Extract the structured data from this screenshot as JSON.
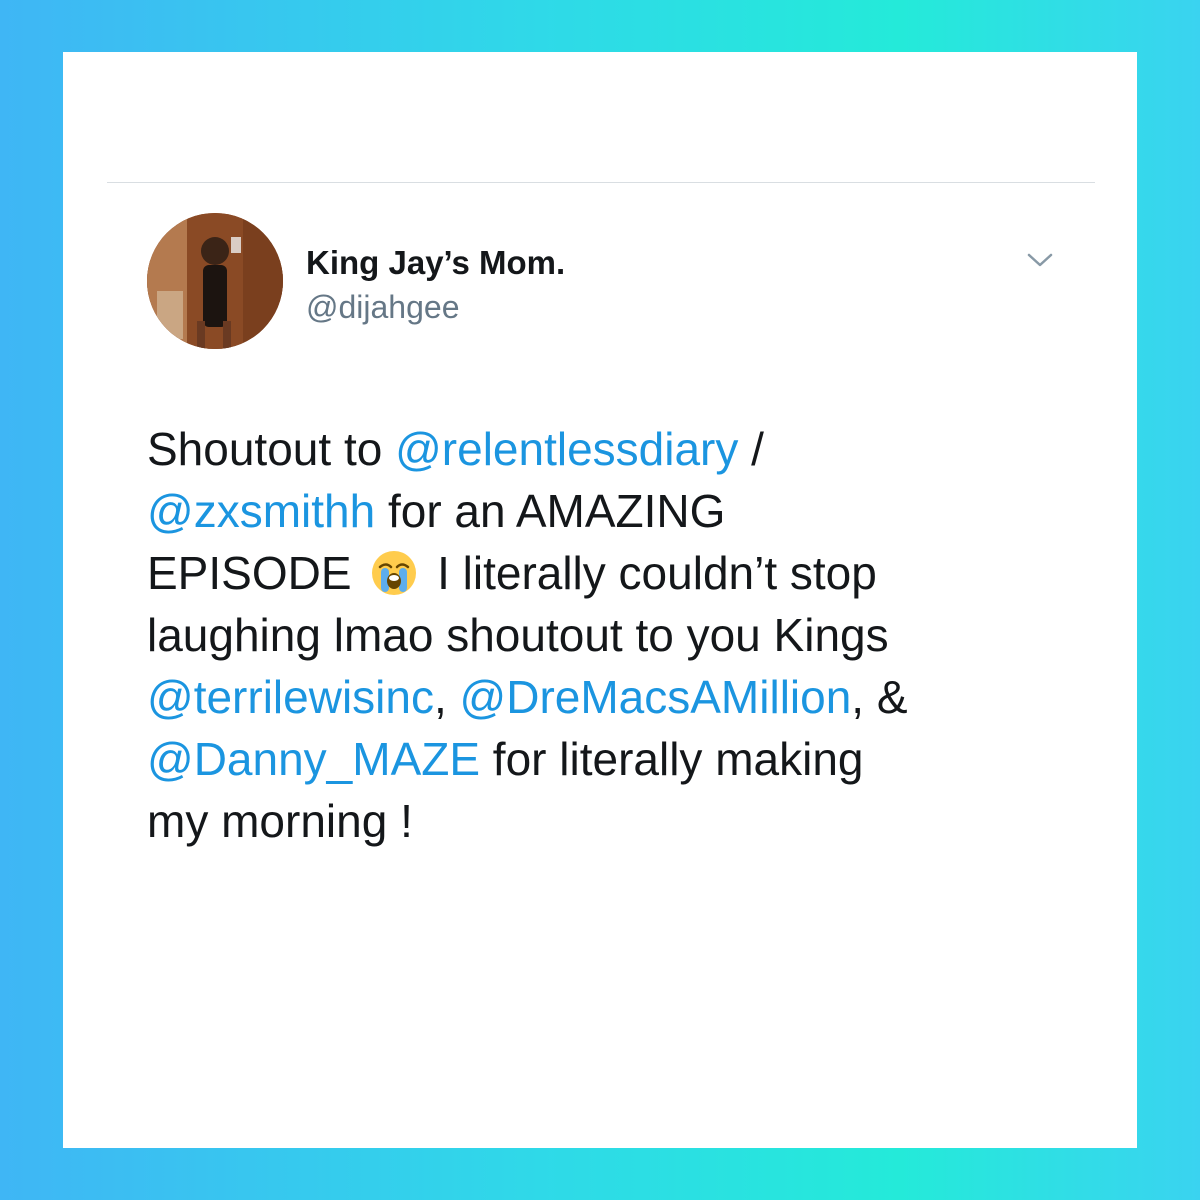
{
  "tweet": {
    "display_name": "King Jay’s Mom.",
    "handle": "@dijahgee",
    "menu_icon": "chevron-down-icon",
    "avatar_icon": "profile-photo",
    "lines": [
      [
        {
          "t": "Shoutout to "
        },
        {
          "m": "@relentlessdiary"
        },
        {
          "t": " /"
        }
      ],
      [
        {
          "m": "@zxsmithh"
        },
        {
          "t": "  for an AMAZING"
        }
      ],
      [
        {
          "t": "EPISODE "
        },
        {
          "e": "loudly-crying-face"
        },
        {
          "t": " I literally couldn’t stop"
        }
      ],
      [
        {
          "t": "laughing lmao shoutout to you Kings"
        }
      ],
      [
        {
          "m": "@terrilewisinc"
        },
        {
          "t": ", "
        },
        {
          "m": "@DreMacsAMillion"
        },
        {
          "t": ", &"
        }
      ],
      [
        {
          "m": "@Danny_MAZE"
        },
        {
          "t": " for literally making"
        }
      ],
      [
        {
          "t": "my morning !"
        }
      ]
    ]
  },
  "colors": {
    "mention": "#1b95e0",
    "text": "#14171a",
    "handle": "#657786",
    "frame_gradient": [
      "#3fb6f5",
      "#24ead9"
    ]
  }
}
